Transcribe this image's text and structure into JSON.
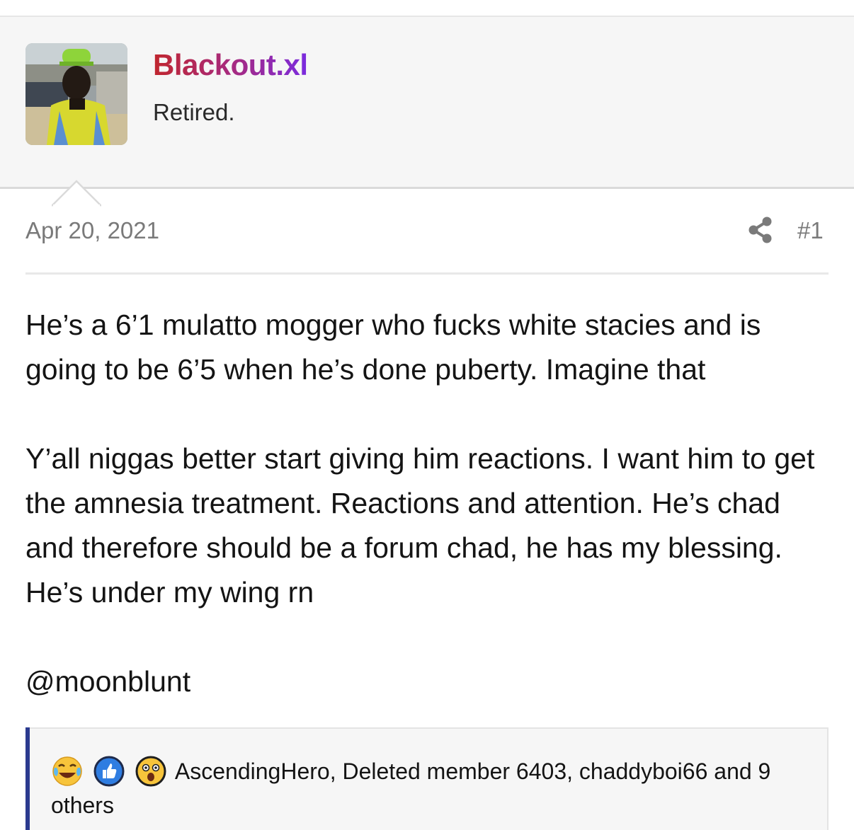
{
  "user": {
    "name": "Blackout.xl",
    "title": "Retired."
  },
  "post": {
    "date": "Apr 20, 2021",
    "number": "#1",
    "paragraphs": [
      "He’s a 6’1 mulatto mogger who fucks white stacies and is going to be 6’5 when he’s done puberty. Imagine that",
      "Y’all niggas better start giving him reactions. I want him to get the amnesia treatment. Reactions and attention. He’s chad and therefore should be a forum chad, he has my blessing. He’s under my wing rn",
      "@moonblunt"
    ]
  },
  "reactions": {
    "icons": [
      "crying-laughing-icon",
      "like-icon",
      "shocked-face-icon"
    ],
    "text": "AscendingHero, Deleted member 6403, chaddyboi66 and 9 others"
  },
  "colors": {
    "username_gradient": [
      "#c0262e",
      "#a42a86",
      "#7a2be0"
    ],
    "reaction_bar": "#2b3a8f",
    "like_blue": "#2f7de1",
    "emoji_yellow": "#f7c43b"
  }
}
